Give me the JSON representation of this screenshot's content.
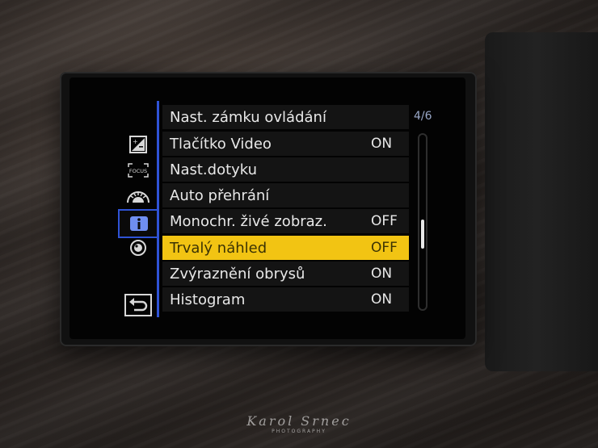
{
  "screen": {
    "page_indicator": "4/6"
  },
  "tabs": [
    {
      "icon": "exposure-compensation-icon"
    },
    {
      "icon": "focus-icon"
    },
    {
      "icon": "custom-settings-icon"
    },
    {
      "icon": "info-icon",
      "selected": true
    },
    {
      "icon": "lens-icon"
    }
  ],
  "back_icon": "return-icon",
  "menu": {
    "items": [
      {
        "label": "Nast. zámku ovládání",
        "value": ""
      },
      {
        "label": "Tlačítko Video",
        "value": "ON"
      },
      {
        "label": "Nast.dotyku",
        "value": ""
      },
      {
        "label": "Auto přehrání",
        "value": ""
      },
      {
        "label": "Monochr. živé zobraz.",
        "value": "OFF"
      },
      {
        "label": "Trvalý náhled",
        "value": "OFF"
      },
      {
        "label": "Zvýraznění obrysů",
        "value": "ON"
      },
      {
        "label": "Histogram",
        "value": "ON"
      }
    ]
  },
  "scroll": {
    "position_fraction": 0.5
  },
  "watermark": {
    "signature": "Karol Srnec",
    "subtitle": "PHOTOGRAPHY"
  },
  "colors": {
    "highlight": "#f2c413",
    "accent_blue": "#2f53d6",
    "row_bg": "#141414"
  }
}
